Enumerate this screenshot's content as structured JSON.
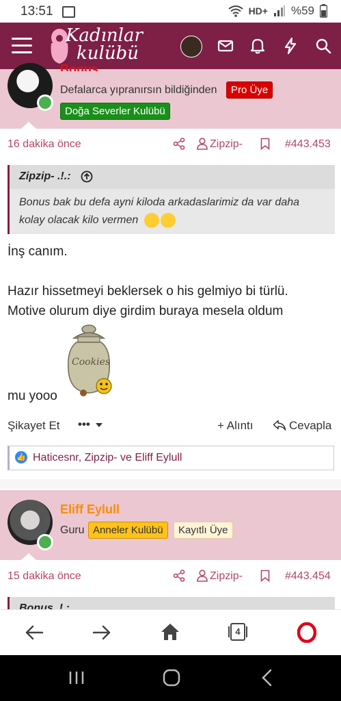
{
  "status_bar": {
    "time": "13:51",
    "network": "HD+",
    "battery": "%59"
  },
  "header": {
    "logo_line1": "Kadınlar",
    "logo_line2": "kulübü"
  },
  "post1": {
    "username": "Bonus",
    "user_title": "Defalarca yıpranırsın bildiğinden",
    "badges": [
      "Pro Üye",
      "Doğa Severler Kulübü"
    ],
    "time": "16 dakika önce",
    "quoted_user": "Zipzip-",
    "post_number": "#443.453",
    "quote_author": "Zipzip- .!.:",
    "quote_text": "Bonus bak bu defa ayni kiloda arkadaslarimiz da var daha kolay olacak kilo vermen",
    "line1": "İnş canım.",
    "line2": "Hazır hissetmeyi beklersek o his gelmiyo bi türlü.",
    "line3": "Motive olurum diye girdim buraya mesela oldum",
    "line4": "mu yooo",
    "report": "Şikayet Et",
    "more": "•••",
    "quote_action": "Alıntı",
    "reply_action": "Cevapla",
    "reactions": "Haticesnr, Zipzip- ve Eliff Eylull",
    "cookie_label": "Cookies"
  },
  "post2": {
    "username": "Eliff Eylull",
    "user_title": "Guru",
    "badges": [
      "Anneler Kulübü",
      "Kayıtlı Üye"
    ],
    "time": "15 dakika önce",
    "quoted_user": "Zipzip-",
    "post_number": "#443.454",
    "quote_author": "Bonus .!.:"
  },
  "browser": {
    "tabs_count": "4"
  }
}
